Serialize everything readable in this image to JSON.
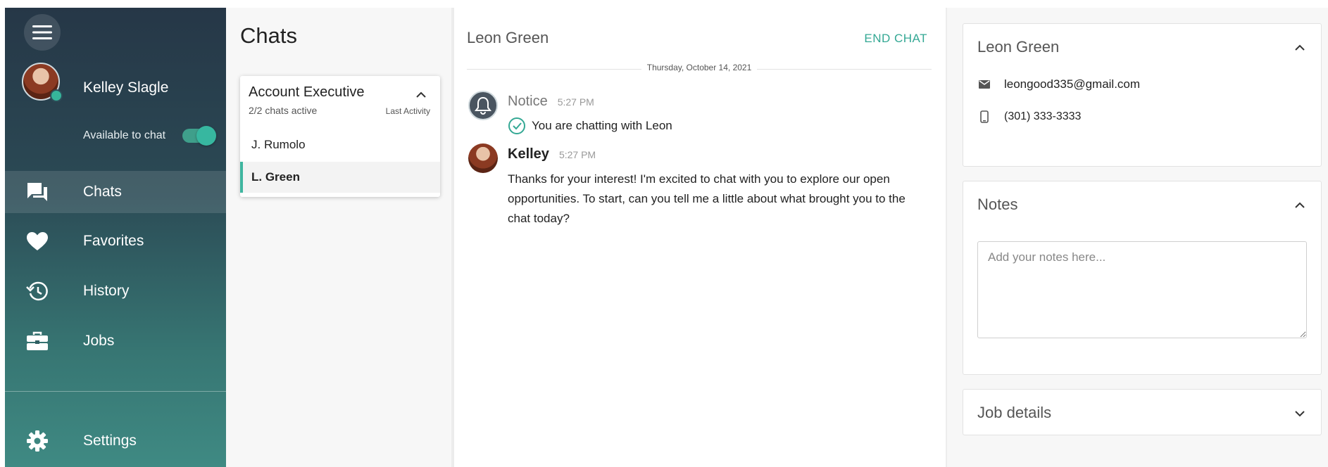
{
  "sidebar": {
    "user_name": "Kelley Slagle",
    "availability_label": "Available to chat",
    "availability_on": true,
    "status_color": "#36b59b",
    "items": [
      {
        "label": "Chats",
        "icon": "chat-icon",
        "active": true
      },
      {
        "label": "Favorites",
        "icon": "heart-icon",
        "active": false
      },
      {
        "label": "History",
        "icon": "history-icon",
        "active": false
      },
      {
        "label": "Jobs",
        "icon": "briefcase-icon",
        "active": false
      }
    ],
    "settings_label": "Settings"
  },
  "chats": {
    "title": "Chats",
    "queue": {
      "name": "Account Executive",
      "active_count": "2/2 chats active",
      "sort_label": "Last Activity",
      "items": [
        {
          "name": "J. Rumolo",
          "selected": false
        },
        {
          "name": "L. Green",
          "selected": true
        }
      ]
    }
  },
  "conversation": {
    "title": "Leon Green",
    "end_chat_label": "END CHAT",
    "date": "Thursday, October 14, 2021",
    "messages": [
      {
        "sender": "Notice",
        "time": "5:27 PM",
        "text": "You are chatting with Leon"
      },
      {
        "sender": "Kelley",
        "time": "5:27 PM",
        "text": "Thanks for your interest! I'm excited to chat with you to explore our open opportunities. To start, can you tell me a little about what brought you to the chat today?"
      }
    ]
  },
  "contact": {
    "name": "Leon Green",
    "email": "leongood335@gmail.com",
    "phone": "(301) 333-3333"
  },
  "notes": {
    "title": "Notes",
    "placeholder": "Add your notes here...",
    "value": ""
  },
  "job_details": {
    "title": "Job details"
  },
  "colors": {
    "accent": "#34a894",
    "sidebar_top": "#263747",
    "sidebar_bottom": "#3f8a83"
  }
}
